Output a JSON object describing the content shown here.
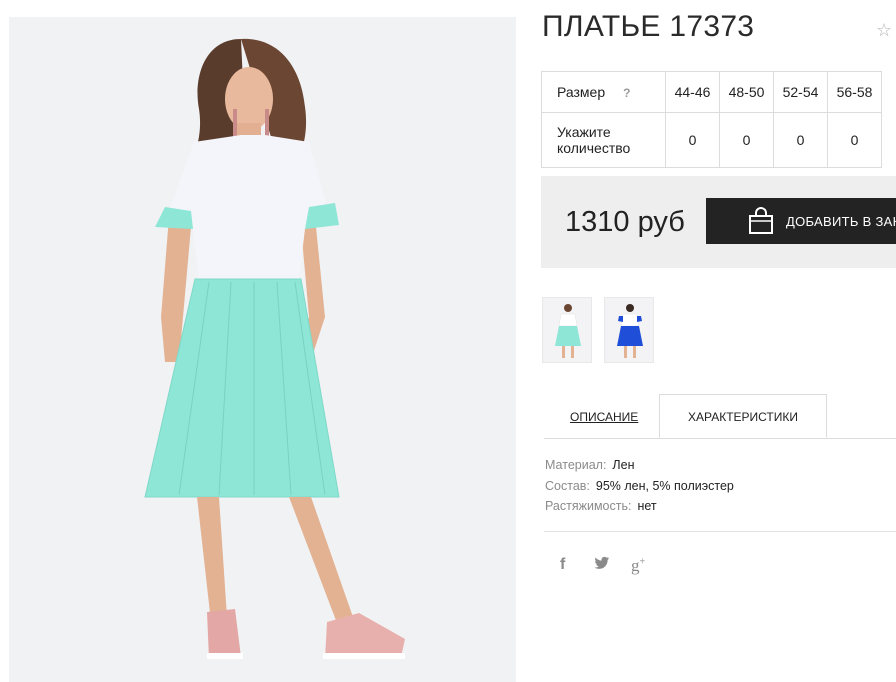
{
  "product": {
    "title": "ПЛАТЬЕ 17373"
  },
  "sizes": {
    "label": "Размер",
    "help": "?",
    "columns": [
      "44-46",
      "48-50",
      "52-54",
      "56-58"
    ],
    "qty_label": "Укажите количество",
    "quantities": [
      "0",
      "0",
      "0",
      "0"
    ]
  },
  "price": {
    "value": "1310 руб",
    "add_to_cart_label": "ДОБАВИТЬ В ЗАКАЗ"
  },
  "tabs": {
    "description": "ОПИСАНИЕ",
    "characteristics": "ХАРАКТЕРИСТИКИ"
  },
  "attributes": [
    {
      "key": "Материал:",
      "value": "Лен"
    },
    {
      "key": "Состав:",
      "value": "95% лен, 5% полиэстер"
    },
    {
      "key": "Растяжимость:",
      "value": "нет"
    }
  ],
  "icons": {
    "favorite": "star-icon",
    "cart": "shopping-bag-icon",
    "social": [
      "facebook-icon",
      "twitter-icon",
      "google-plus-icon"
    ]
  },
  "colors": {
    "dress_top": "#f4f5fa",
    "dress_skirt": "#8ee6d6",
    "button_bg": "#232323",
    "price_bg": "#eeeeee"
  }
}
